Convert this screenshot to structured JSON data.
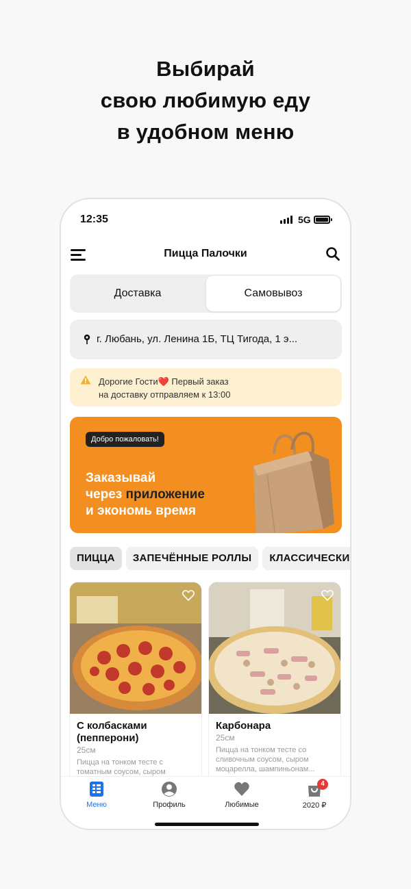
{
  "headline": [
    "Выбирай",
    "свою любимую еду",
    "в удобном меню"
  ],
  "status": {
    "time": "12:35",
    "network": "5G"
  },
  "appbar": {
    "title": "Пицца Палочки",
    "menu_icon": "hamburger-icon",
    "search_icon": "search-icon"
  },
  "mode_switch": {
    "delivery": "Доставка",
    "pickup": "Самовывоз",
    "selected": "pickup"
  },
  "address": {
    "text": "г. Любань, ул. Ленина 1Б, ТЦ Тигода, 1 э..."
  },
  "notice": {
    "line1": "Дорогие Гости❤️ Первый заказ",
    "line2": "на доставку отправляем к 13:00",
    "color": "#fdf1d2"
  },
  "banner": {
    "badge": "Добро пожаловать!",
    "line1": "Заказывай",
    "line2_white": "через ",
    "line2_dark": "приложение",
    "line3": "и экономь время",
    "color": "#f28f20"
  },
  "categories": [
    "ПИЦЦА",
    "ЗАПЕЧЁННЫЕ РОЛЛЫ",
    "КЛАССИЧЕСКИЕ"
  ],
  "products": [
    {
      "name": "С колбасками (пепперони)",
      "size": "25см",
      "desc": "Пицца на тонком тесте с томатным соусом, сыром"
    },
    {
      "name": "Карбонара",
      "size": "25см",
      "desc": "Пицца на тонком тесте со сливочным соусом, сыром моцарелла, шампиньонам..."
    }
  ],
  "tabbar": {
    "menu": "Меню",
    "profile": "Профиль",
    "favorites": "Любимые",
    "cart": "2020 ₽",
    "cart_count": "4",
    "active_color": "#1a73e8"
  }
}
